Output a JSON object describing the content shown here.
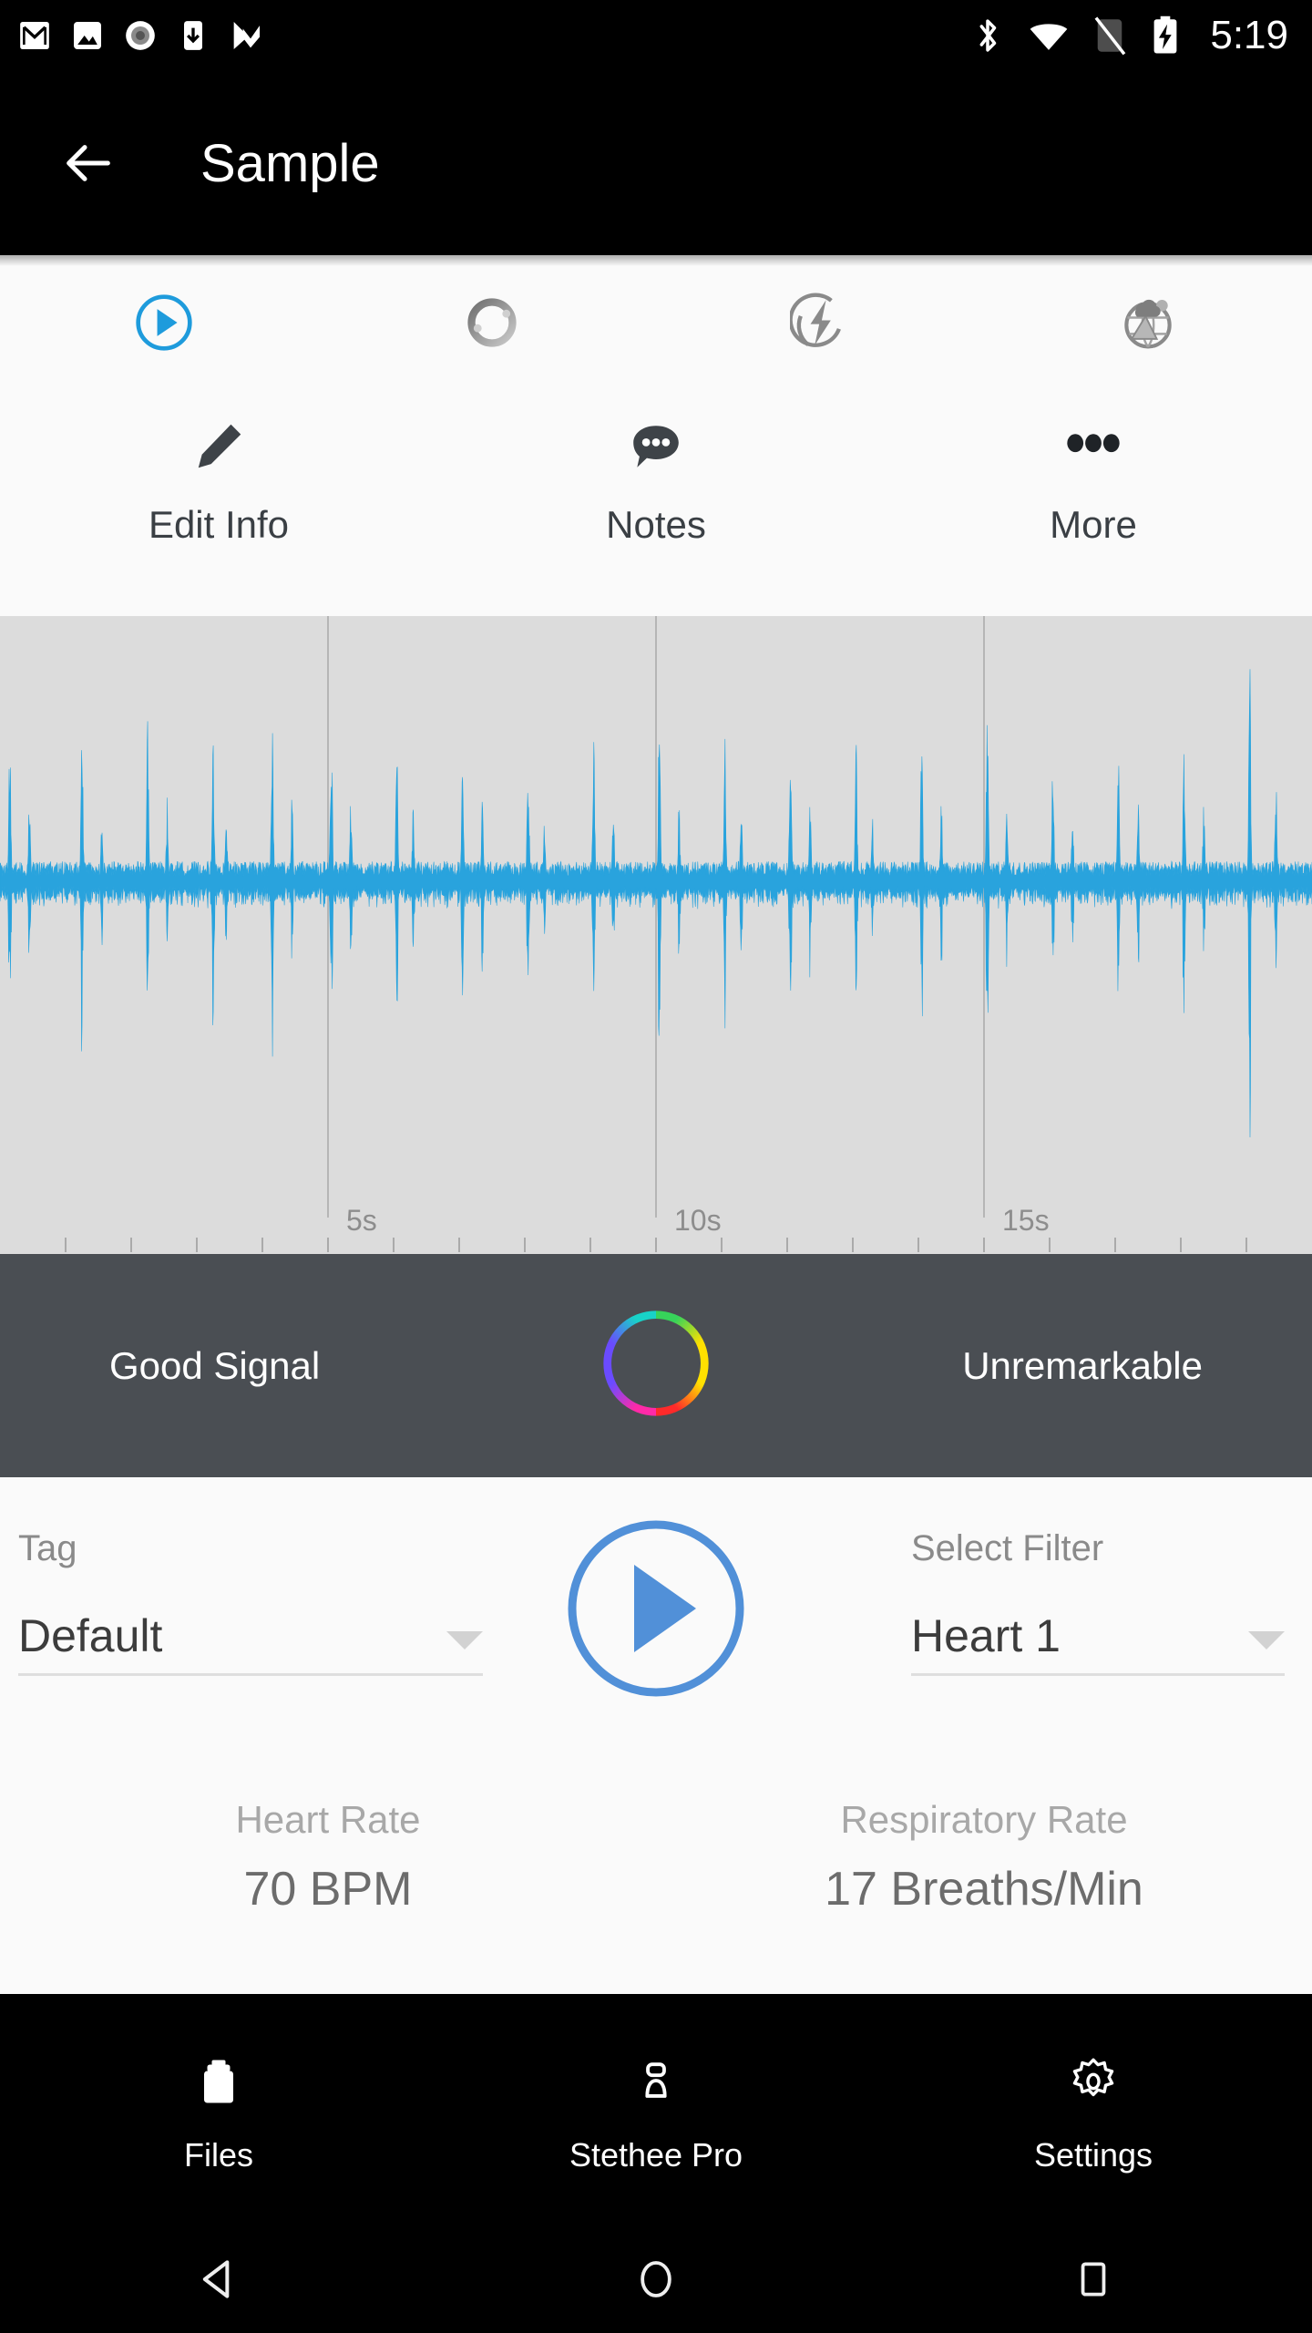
{
  "status_bar": {
    "time": "5:19",
    "left_icons": [
      "gmail-icon",
      "photos-icon",
      "record-circle-icon",
      "download-to-phone-icon",
      "play-check-icon"
    ],
    "right_icons": [
      "bluetooth-icon",
      "wifi-icon",
      "no-sim-icon",
      "battery-charging-icon"
    ]
  },
  "toolbar": {
    "back_icon": "back-arrow-icon",
    "title": "Sample"
  },
  "tabs": [
    {
      "name": "playback",
      "icon": "play-circle-icon",
      "active": true
    },
    {
      "name": "signal-quality",
      "icon": "ring-circle-icon",
      "active": false
    },
    {
      "name": "energy",
      "icon": "lightning-circle-icon",
      "active": false
    },
    {
      "name": "environment",
      "icon": "globe-weather-icon",
      "active": false
    }
  ],
  "actions": [
    {
      "label": "Edit Info",
      "icon": "pencil-icon"
    },
    {
      "label": "Notes",
      "icon": "speech-bubble-icon"
    },
    {
      "label": "More",
      "icon": "three-dots-icon"
    }
  ],
  "chart_data": {
    "type": "line",
    "title": "",
    "xlabel": "",
    "ylabel": "",
    "tick_labels": [
      "5s",
      "10s",
      "15s"
    ],
    "major_gridlines_s": [
      5,
      10,
      15
    ],
    "minor_tick_interval_s": 1,
    "xlim": [
      0,
      20
    ],
    "ylim": [
      -1,
      1
    ],
    "grid": true,
    "series": [
      {
        "name": "Heart sound waveform",
        "color": "#29a3dd",
        "description": "Phonocardiogram amplitude envelope with periodic S1/S2 beat spikes",
        "beat_times_s": [
          0.15,
          0.45,
          1.25,
          1.55,
          2.25,
          2.55,
          3.25,
          3.45,
          4.15,
          4.45,
          5.05,
          5.35,
          6.05,
          6.3,
          7.05,
          7.35,
          8.05,
          8.3,
          9.05,
          9.35,
          10.05,
          10.35,
          11.05,
          11.3,
          12.05,
          12.35,
          13.05,
          13.3,
          14.05,
          14.35,
          15.05,
          15.35,
          16.05,
          16.35,
          17.05,
          17.35,
          18.05,
          18.35,
          19.05,
          19.45
        ],
        "beat_amplitudes": [
          0.62,
          0.4,
          0.7,
          0.28,
          0.66,
          0.34,
          0.55,
          0.3,
          0.64,
          0.36,
          0.72,
          0.38,
          0.58,
          0.32,
          0.6,
          0.34,
          0.56,
          0.3,
          0.62,
          0.36,
          0.68,
          0.33,
          0.59,
          0.31,
          0.65,
          0.35,
          0.57,
          0.29,
          0.61,
          0.33,
          0.7,
          0.37,
          0.54,
          0.3,
          0.63,
          0.34,
          0.58,
          0.31,
          0.95,
          0.42
        ],
        "noise_floor": 0.07
      }
    ]
  },
  "signal_bar": {
    "quality_label": "Good Signal",
    "assessment_label": "Unremarkable",
    "ring_icon": "rainbow-ring-icon",
    "background_color": "#4a4e53"
  },
  "controls": {
    "tag": {
      "label": "Tag",
      "value": "Default",
      "caret_icon": "chevron-down-icon"
    },
    "filter": {
      "label": "Select Filter",
      "value": "Heart 1",
      "caret_icon": "chevron-down-icon"
    },
    "play": {
      "icon": "play-circle-icon",
      "color": "#5190d8"
    }
  },
  "metrics": [
    {
      "label": "Heart Rate",
      "value": "70 BPM"
    },
    {
      "label": "Respiratory Rate",
      "value": "17 Breaths/Min"
    }
  ],
  "bottom_nav": [
    {
      "label": "Files",
      "icon": "briefcase-icon",
      "active": true
    },
    {
      "label": "Stethee Pro",
      "icon": "stethee-device-icon",
      "active": false
    },
    {
      "label": "Settings",
      "icon": "gear-icon",
      "active": false
    }
  ],
  "android_nav": [
    {
      "name": "back",
      "icon": "triangle-back-icon"
    },
    {
      "name": "home",
      "icon": "circle-home-icon"
    },
    {
      "name": "recents",
      "icon": "square-recents-icon"
    }
  ],
  "colors": {
    "accent_blue": "#2196d5",
    "wave_blue": "#29a3dd",
    "play_blue": "#5190d8",
    "wave_bg": "#dcdcdc",
    "signal_bg": "#4a4e53",
    "content_bg": "#fafafa"
  }
}
